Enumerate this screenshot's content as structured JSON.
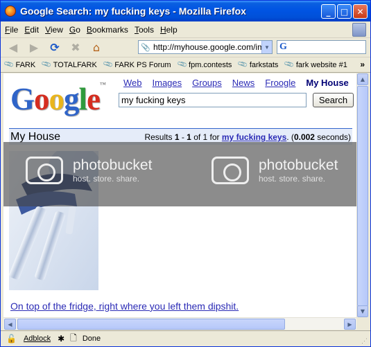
{
  "window": {
    "title": "Google Search: my fucking keys - Mozilla Firefox",
    "minimize": "_",
    "maximize": "□",
    "close": "✕"
  },
  "menu": [
    "File",
    "Edit",
    "View",
    "Go",
    "Bookmarks",
    "Tools",
    "Help"
  ],
  "navigation": {
    "url": "http://myhouse.google.com/ima",
    "back_icon": "back-arrow-icon",
    "forward_icon": "forward-arrow-icon",
    "reload_icon": "reload-icon",
    "stop_icon": "stop-icon",
    "home_icon": "home-icon"
  },
  "bookmarks": [
    "FARK",
    "TOTALFARK",
    "FARK PS Forum",
    "fpm.contests",
    "farkstats",
    "fark website #1"
  ],
  "bookmarks_overflow": "»",
  "google": {
    "logo_letters": [
      "G",
      "o",
      "o",
      "g",
      "l",
      "e"
    ],
    "logo_tm": "™",
    "tabs": [
      "Web",
      "Images",
      "Groups",
      "News",
      "Froogle"
    ],
    "active_tab": "My House",
    "query": "my fucking keys",
    "search_button": "Search",
    "section_title": "My House",
    "results_prefix": "Results ",
    "results_from": "1",
    "results_dash": " - ",
    "results_to": "1",
    "results_of": " of 1 for ",
    "results_query": "my fucking keys",
    "results_time_open": ". (",
    "results_time": "0.002",
    "results_time_close": " seconds)",
    "result_link": "On top of the fridge, right where you left them dipshit."
  },
  "watermark": {
    "brand": "photobucket",
    "tagline": "host. store. share."
  },
  "status": {
    "adblock": "Adblock",
    "text": "Done"
  },
  "colors": {
    "titlebar": "#0054e3",
    "link": "#2a2ab5",
    "result_bar": "#e5ecf9"
  }
}
